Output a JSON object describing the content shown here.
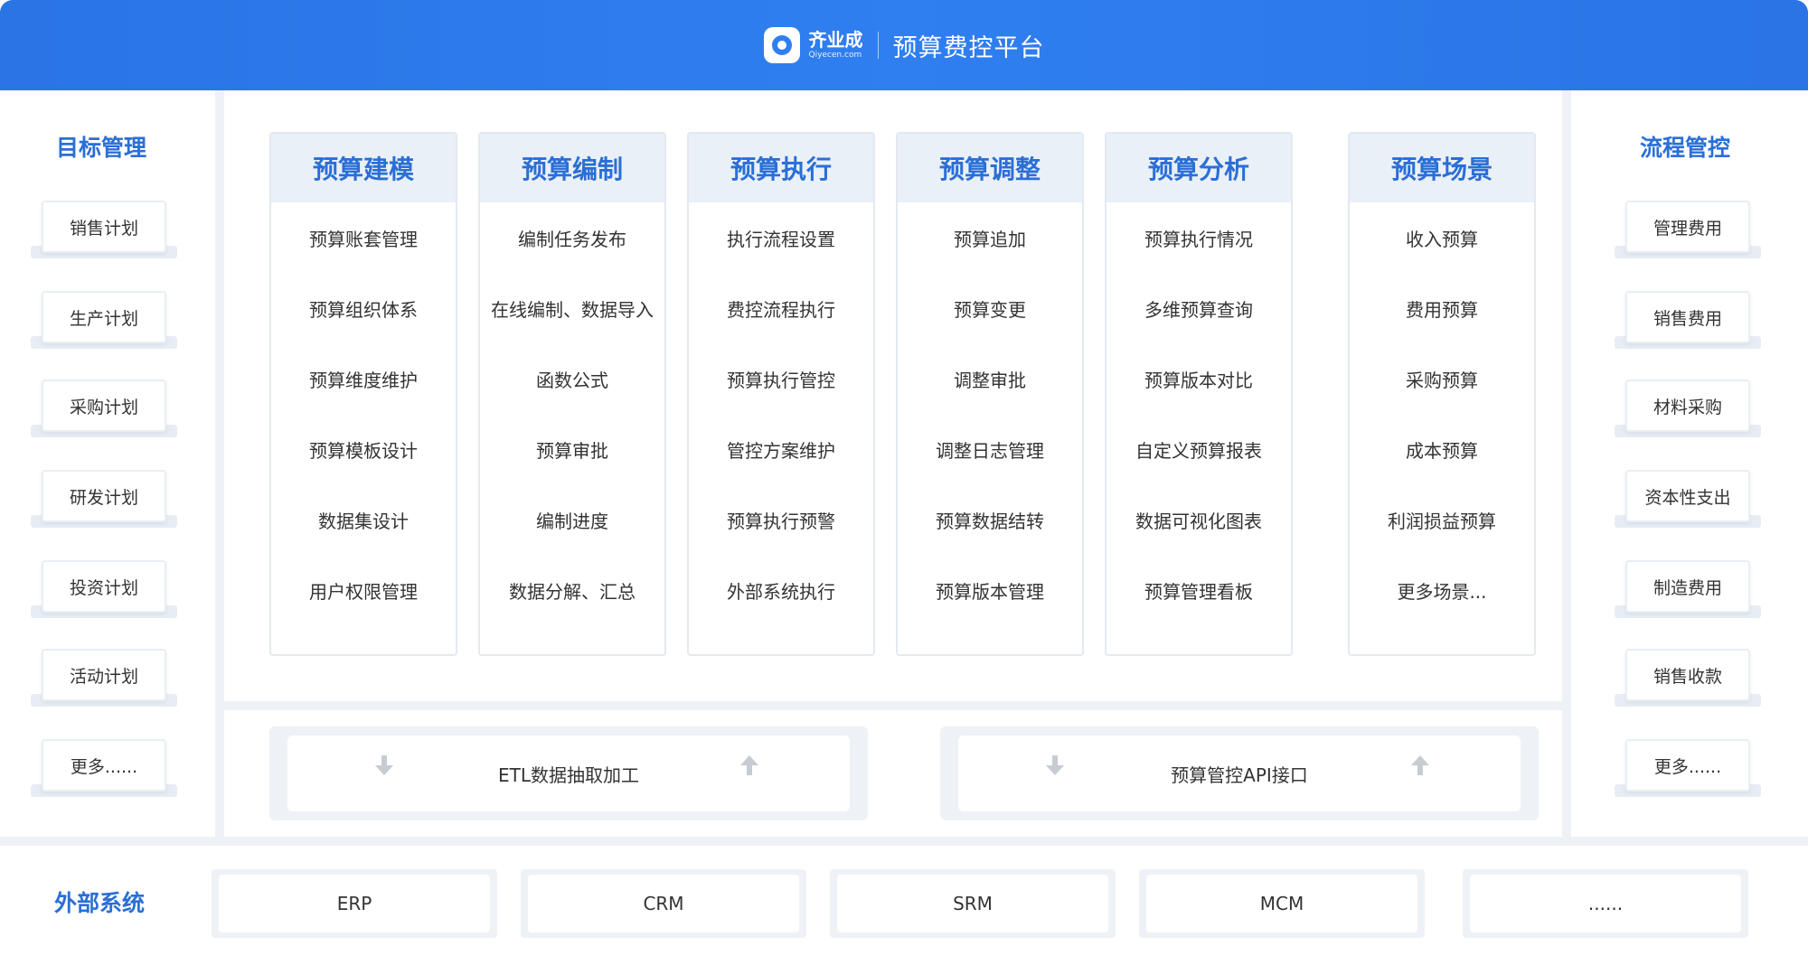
{
  "header": {
    "logo_cn": "齐业成",
    "logo_en": "Qiyecen.com",
    "title": "预算费控平台"
  },
  "left": {
    "title": "目标管理",
    "items": [
      "销售计划",
      "生产计划",
      "采购计划",
      "研发计划",
      "投资计划",
      "活动计划",
      "更多......"
    ]
  },
  "right": {
    "title": "流程管控",
    "items": [
      "管理费用",
      "销售费用",
      "材料采购",
      "资本性支出",
      "制造费用",
      "销售收款",
      "更多......"
    ]
  },
  "modules": [
    {
      "title": "预算建模",
      "items": [
        "预算账套管理",
        "预算组织体系",
        "预算维度维护",
        "预算模板设计",
        "数据集设计",
        "用户权限管理"
      ]
    },
    {
      "title": "预算编制",
      "items": [
        "编制任务发布",
        "在线编制、数据导入",
        "函数公式",
        "预算审批",
        "编制进度",
        "数据分解、汇总"
      ]
    },
    {
      "title": "预算执行",
      "items": [
        "执行流程设置",
        "费控流程执行",
        "预算执行管控",
        "管控方案维护",
        "预算执行预警",
        "外部系统执行"
      ]
    },
    {
      "title": "预算调整",
      "items": [
        "预算追加",
        "预算变更",
        "调整审批",
        "调整日志管理",
        "预算数据结转",
        "预算版本管理"
      ]
    },
    {
      "title": "预算分析",
      "items": [
        "预算执行情况",
        "多维预算查询",
        "预算版本对比",
        "自定义预算报表",
        "数据可视化图表",
        "预算管理看板"
      ]
    },
    {
      "title": "预算场景",
      "items": [
        "收入预算",
        "费用预算",
        "采购预算",
        "成本预算",
        "利润损益预算",
        "更多场景..."
      ]
    }
  ],
  "interfaces": [
    "ETL数据抽取加工",
    "预算管控API接口"
  ],
  "external": {
    "title": "外部系统",
    "items": [
      "ERP",
      "CRM",
      "SRM",
      "MCM",
      "......"
    ]
  }
}
